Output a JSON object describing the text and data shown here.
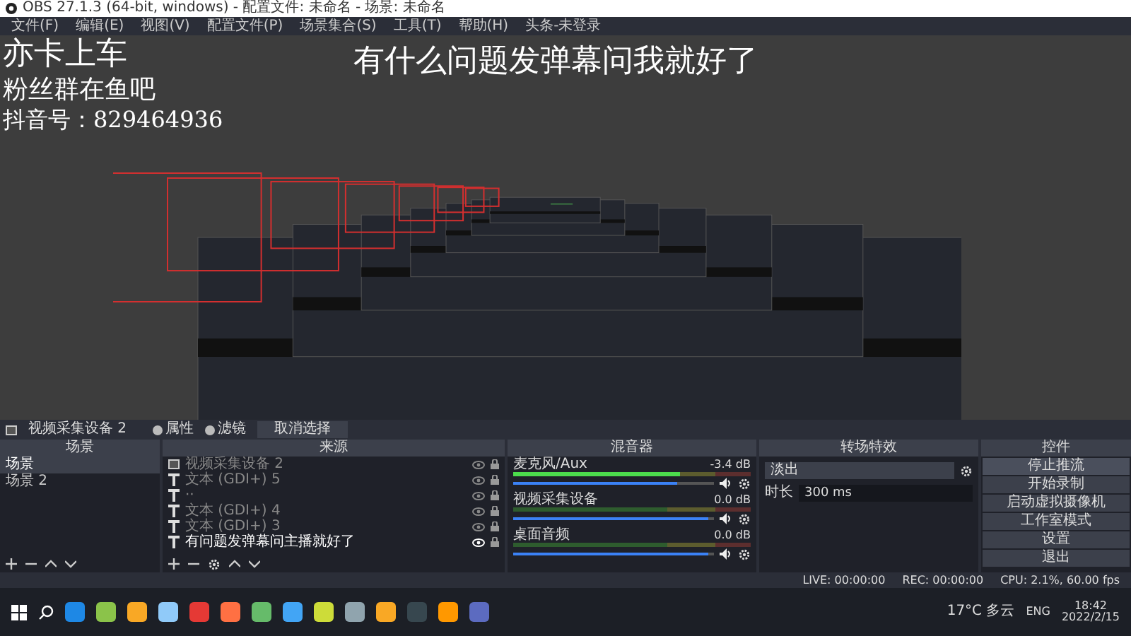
{
  "window": {
    "title": "OBS 27.1.3 (64-bit, windows) - 配置文件: 未命名 - 场景: 未命名"
  },
  "menu": [
    "文件(F)",
    "编辑(E)",
    "视图(V)",
    "配置文件(P)",
    "场景集合(S)",
    "工具(T)",
    "帮助(H)",
    "头条-未登录"
  ],
  "preview": {
    "overlay_lines": [
      "亦卡上车",
      "粉丝群在鱼吧",
      "抖音号：829464936"
    ],
    "banner": "有什么问题发弹幕问我就好了"
  },
  "toolbar": {
    "source_name": "视频采集设备 2",
    "buttons": [
      "属性",
      "滤镜"
    ],
    "deselect": "取消选择"
  },
  "scenes": {
    "title": "场景",
    "items": [
      {
        "name": "场景",
        "selected": true
      },
      {
        "name": "场景 2",
        "selected": false
      }
    ]
  },
  "sources": {
    "title": "来源",
    "items": [
      {
        "kind": "video",
        "name": "视频采集设备 2",
        "visible": false
      },
      {
        "kind": "text",
        "name": "文本 (GDI+) 5",
        "visible": false
      },
      {
        "kind": "text",
        "name": "··",
        "visible": false
      },
      {
        "kind": "text",
        "name": "文本 (GDI+) 4",
        "visible": false
      },
      {
        "kind": "text",
        "name": "文本 (GDI+) 3",
        "visible": false
      },
      {
        "kind": "text",
        "name": "有问题发弹幕问主播就好了",
        "visible": true
      }
    ]
  },
  "mixer": {
    "title": "混音器",
    "channels": [
      {
        "name": "麦克风/Aux",
        "reading": "-3.4 dB",
        "meter": {
          "level": 0.7
        },
        "slider": {
          "level": 0.82
        }
      },
      {
        "name": "视频采集设备",
        "reading": "0.0 dB",
        "meter": {
          "level": 0
        },
        "slider": {
          "level": 0.97
        }
      },
      {
        "name": "桌面音频",
        "reading": "0.0 dB",
        "meter": {
          "level": 0
        },
        "slider": {
          "level": 0.97
        }
      }
    ]
  },
  "transitions": {
    "title": "转场特效",
    "selected": "淡出",
    "duration_label": "时长",
    "duration": "300 ms"
  },
  "controls": {
    "title": "控件",
    "buttons": [
      "停止推流",
      "开始录制",
      "启动虚拟摄像机",
      "工作室模式",
      "设置",
      "退出"
    ]
  },
  "status_bar": {
    "live": "LIVE: 00:00:00",
    "rec": "REC: 00:00:00",
    "cpu": "CPU: 2.1%, 60.00 fps"
  },
  "taskbar": {
    "weather": "17°C 多云",
    "language": "ENG",
    "time": "18:42",
    "date": "2022/2/15"
  }
}
